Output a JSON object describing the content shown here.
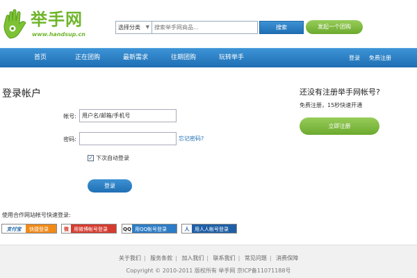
{
  "logo": {
    "name": "举手网",
    "url": "www.handsup.cn"
  },
  "search": {
    "category": "选择分类",
    "placeholder": "搜索举手网商品...",
    "button": "搜索",
    "start_group": "发起一个团购"
  },
  "nav": {
    "items": [
      "首页",
      "正在团购",
      "最新需求",
      "往期团购",
      "玩转举手"
    ],
    "login": "登录",
    "register": "免费注册"
  },
  "login": {
    "title": "登录帐户",
    "account_label": "帐号:",
    "account_value": "用户名/邮箱/手机号",
    "password_label": "密码:",
    "password_value": "",
    "forgot": "忘记密码?",
    "remember": "下次自动登录",
    "remember_checked": true,
    "submit": "登录"
  },
  "register": {
    "title": "还没有注册举手网帐号?",
    "subtitle": "免费注册，15秒快速开通",
    "button": "立即注册"
  },
  "partners": {
    "title": "使用合作网站帐号快速登录:",
    "items": [
      {
        "icon_text": "支付宝",
        "label": "快捷登录",
        "color": "#f08a19",
        "icon_bg": "#ffffff",
        "icon_color": "#1c63a6"
      },
      {
        "icon_text": "微",
        "label": "用微博帐号登录",
        "color": "#d43c2f",
        "icon_bg": "#ffffff",
        "icon_color": "#d43c2f"
      },
      {
        "icon_text": "QQ",
        "label": "用QQ帐号登录",
        "color": "#2d7cc5",
        "icon_bg": "#ffffff",
        "icon_color": "#222222"
      },
      {
        "icon_text": "人",
        "label": "用人人帐号登录",
        "color": "#1f5fa6",
        "icon_bg": "#ffffff",
        "icon_color": "#1f5fa6"
      }
    ]
  },
  "footer": {
    "links": [
      "关于我们",
      "服务条款",
      "加入我们",
      "联系我们",
      "常见问题",
      "消费保障"
    ],
    "copyright": "Copyright © 2010-2011 版权所有 举手网 京ICP备11071188号"
  },
  "colors": {
    "brand_green": "#6fb52c",
    "nav_blue": "#2a7cc2"
  }
}
